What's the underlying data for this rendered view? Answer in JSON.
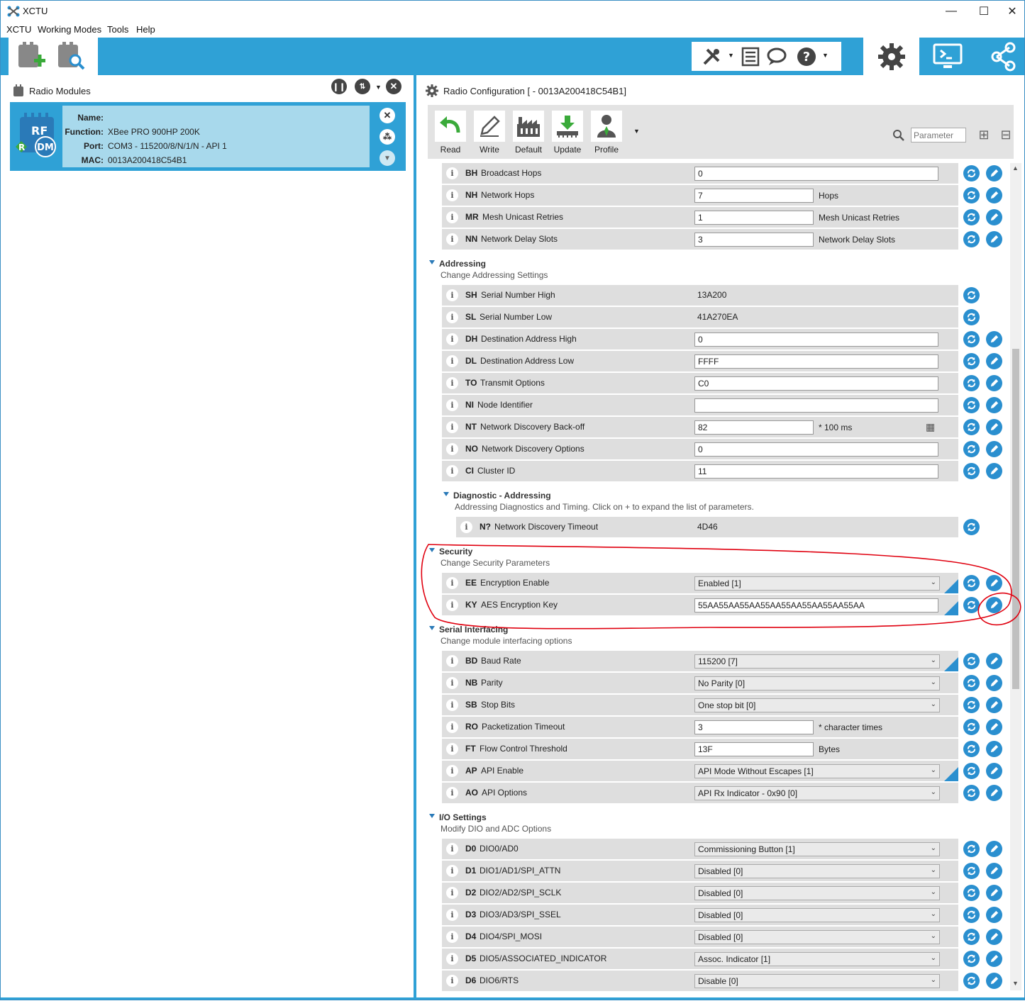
{
  "app": {
    "title": "XCTU"
  },
  "menu": [
    "XCTU",
    "Working Modes",
    "Tools",
    "Help"
  ],
  "left_pane": {
    "title": "Radio Modules",
    "module": {
      "name_label": "Name:",
      "name": "",
      "function_label": "Function:",
      "function": "XBee PRO 900HP 200K",
      "port_label": "Port:",
      "port": "COM3 - 115200/8/N/1/N - API 1",
      "mac_label": "MAC:",
      "mac": "0013A200418C54B1",
      "icon_text_top": "RF",
      "icon_text_r": "R",
      "icon_text_dm": "DM"
    }
  },
  "right_pane": {
    "title": "Radio Configuration [ - 0013A200418C54B1]",
    "buttons": [
      "Read",
      "Write",
      "Default",
      "Update",
      "Profile"
    ],
    "search_placeholder": "Parameter"
  },
  "network_rows": [
    {
      "code": "BH",
      "name": "Broadcast Hops",
      "value": "0",
      "unit": ""
    },
    {
      "code": "NH",
      "name": "Network Hops",
      "value": "7",
      "unit": "Hops"
    },
    {
      "code": "MR",
      "name": "Mesh Unicast Retries",
      "value": "1",
      "unit": "Mesh Unicast Retries"
    },
    {
      "code": "NN",
      "name": "Network Delay Slots",
      "value": "3",
      "unit": "Network Delay Slots"
    }
  ],
  "addressing": {
    "title": "Addressing",
    "desc": "Change Addressing Settings",
    "rows": [
      {
        "code": "SH",
        "name": "Serial Number High",
        "value": "13A200"
      },
      {
        "code": "SL",
        "name": "Serial Number Low",
        "value": "41A270EA"
      },
      {
        "code": "DH",
        "name": "Destination Address High",
        "value": "0"
      },
      {
        "code": "DL",
        "name": "Destination Address Low",
        "value": "FFFF"
      },
      {
        "code": "TO",
        "name": "Transmit Options",
        "value": "C0"
      },
      {
        "code": "NI",
        "name": "Node Identifier",
        "value": ""
      },
      {
        "code": "NT",
        "name": "Network Discovery Back-off",
        "value": "82",
        "unit": "* 100 ms"
      },
      {
        "code": "NO",
        "name": "Network Discovery Options",
        "value": "0"
      },
      {
        "code": "CI",
        "name": "Cluster ID",
        "value": "11"
      }
    ]
  },
  "diag": {
    "title": "Diagnostic - Addressing",
    "desc": "Addressing Diagnostics and Timing. Click on + to expand the list of parameters.",
    "row": {
      "code": "N?",
      "name": "Network Discovery Timeout",
      "value": "4D46"
    }
  },
  "security": {
    "title": "Security",
    "desc": "Change Security Parameters",
    "rows": [
      {
        "code": "EE",
        "name": "Encryption Enable",
        "value": "Enabled [1]"
      },
      {
        "code": "KY",
        "name": "AES Encryption Key",
        "value": "55AA55AA55AA55AA55AA55AA55AA55AA"
      }
    ]
  },
  "serial": {
    "title": "Serial Interfacing",
    "desc": "Change module interfacing options",
    "rows": [
      {
        "code": "BD",
        "name": "Baud Rate",
        "value": "115200 [7]"
      },
      {
        "code": "NB",
        "name": "Parity",
        "value": "No Parity [0]"
      },
      {
        "code": "SB",
        "name": "Stop Bits",
        "value": "One stop bit [0]"
      },
      {
        "code": "RO",
        "name": "Packetization Timeout",
        "value": "3",
        "unit": "* character times"
      },
      {
        "code": "FT",
        "name": "Flow Control Threshold",
        "value": "13F",
        "unit": "Bytes"
      },
      {
        "code": "AP",
        "name": "API Enable",
        "value": "API Mode Without Escapes [1]"
      },
      {
        "code": "AO",
        "name": "API Options",
        "value": "API Rx Indicator - 0x90 [0]"
      }
    ]
  },
  "io": {
    "title": "I/O Settings",
    "desc": "Modify DIO and ADC Options",
    "rows": [
      {
        "code": "D0",
        "name": "DIO0/AD0",
        "value": "Commissioning Button [1]"
      },
      {
        "code": "D1",
        "name": "DIO1/AD1/SPI_ATTN",
        "value": "Disabled [0]"
      },
      {
        "code": "D2",
        "name": "DIO2/AD2/SPI_SCLK",
        "value": "Disabled [0]"
      },
      {
        "code": "D3",
        "name": "DIO3/AD3/SPI_SSEL",
        "value": "Disabled [0]"
      },
      {
        "code": "D4",
        "name": "DIO4/SPI_MOSI",
        "value": "Disabled [0]"
      },
      {
        "code": "D5",
        "name": "DIO5/ASSOCIATED_INDICATOR",
        "value": "Assoc. Indicator [1]"
      },
      {
        "code": "D6",
        "name": "DIO6/RTS",
        "value": "Disable [0]"
      }
    ]
  },
  "colors": {
    "accent": "#2fa1d6",
    "row_bg": "#dedede",
    "annotation": "#e0000f"
  }
}
